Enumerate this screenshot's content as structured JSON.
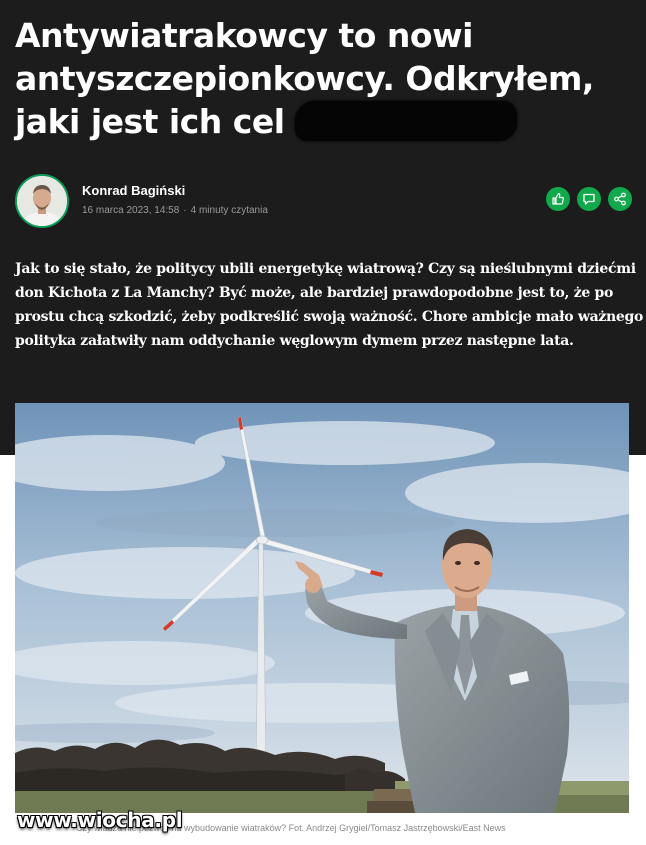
{
  "article": {
    "title_lines": [
      "Antywiatrakowcy to nowi",
      "antyszczepionkowcy. Odkryłem,",
      "jaki jest ich cel"
    ],
    "author": {
      "name": "Konrad Bagiński",
      "date": "16 marca 2023, 14:58",
      "separator": "·",
      "reading_time": "4 minuty czytania"
    },
    "share_icons": [
      "like-icon",
      "comment-icon",
      "share-icon"
    ],
    "lead_lines": [
      "Jak to się stało, że politycy ubili energetykę wiatrową? Czy są nieślubnymi dziećmi",
      "don Kichota z La Manchy? Być może, ale bardziej prawdopodobne jest to, że po",
      "prostu chcą szkodzić, żeby podkreślić swoją ważność. Chore ambicje mało ważnego",
      "polityka załatwiły nam oddychanie węglowym dymem przez następne lata."
    ],
    "photo_caption": "Czy władza nie pozwoli na wybudowanie wiatraków? Fot. Andrzej Grygiel/Tomasz Jastrzębowski/East News"
  },
  "watermark": "www.wiocha.pl",
  "colors": {
    "header_background": "#1c1c1c",
    "accent_green": "#12a84c",
    "text_white": "#ffffff",
    "meta_gray": "#9a9a9a"
  }
}
